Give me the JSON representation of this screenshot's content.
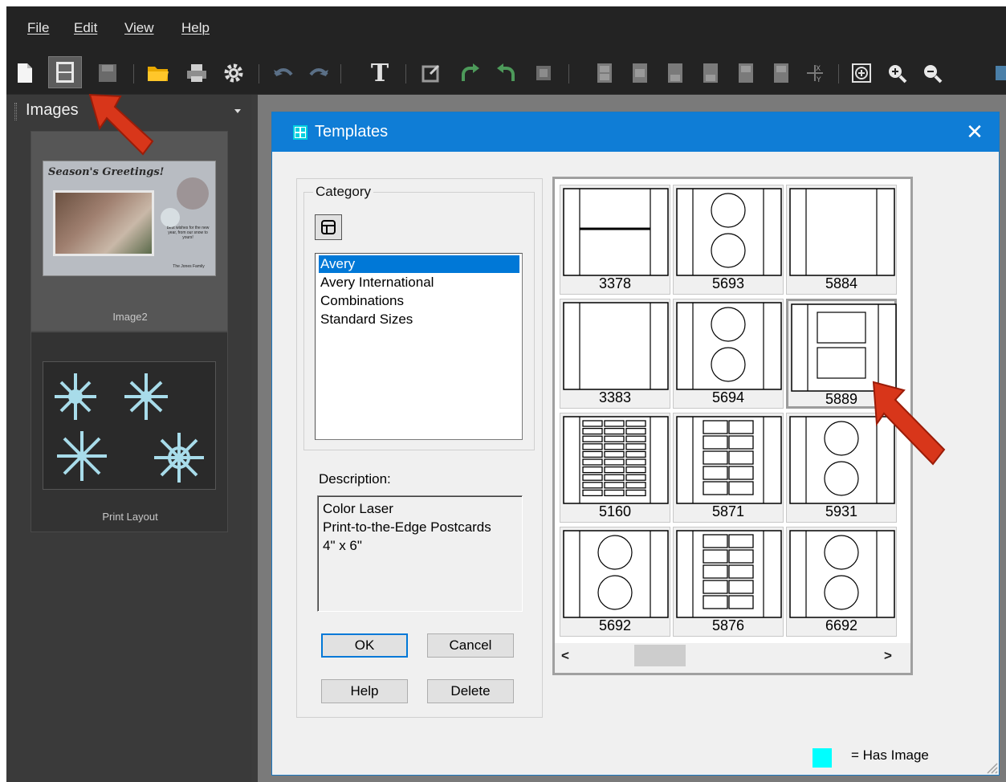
{
  "menu": {
    "file": "File",
    "edit": "Edit",
    "view": "View",
    "help": "Help"
  },
  "toolbar": {
    "items": [
      "new-document-icon",
      "layout-icon",
      "save-icon",
      "open-folder-icon",
      "print-icon",
      "settings-icon",
      "undo-icon",
      "redo-icon",
      "text-icon",
      "edit-image-icon",
      "rotate-right-icon",
      "rotate-left-icon",
      "crop-icon",
      "grid-icon-1",
      "grid-icon-2",
      "grid-icon-3",
      "grid-icon-4",
      "grid-icon-5",
      "grid-icon-6",
      "xy-icon",
      "fit-icon",
      "zoom-in-icon",
      "zoom-out-icon"
    ]
  },
  "images_panel": {
    "title": "Images",
    "items": [
      {
        "label": "Image2",
        "selected": true
      },
      {
        "label": "Print Layout",
        "selected": false
      }
    ],
    "postcard": {
      "heading": "Season's Greetings!",
      "message": "Best wishes for the new year, from our snow to yours!",
      "signature": "The Jones Family"
    }
  },
  "dialog": {
    "title": "Templates",
    "category_label": "Category",
    "categories": [
      {
        "label": "Avery",
        "selected": true
      },
      {
        "label": "Avery International",
        "selected": false
      },
      {
        "label": "Combinations",
        "selected": false
      },
      {
        "label": "Standard Sizes",
        "selected": false
      }
    ],
    "description_label": "Description:",
    "description_lines": [
      "Color Laser",
      "Print-to-the-Edge Postcards",
      "4\" x 6\""
    ],
    "buttons": {
      "ok": "OK",
      "cancel": "Cancel",
      "help": "Help",
      "delete": "Delete"
    },
    "templates": [
      {
        "id": "3378",
        "layout": "hsplit"
      },
      {
        "id": "5693",
        "layout": "two-circles"
      },
      {
        "id": "5884",
        "layout": "full"
      },
      {
        "id": "3383",
        "layout": "full"
      },
      {
        "id": "5694",
        "layout": "two-circles"
      },
      {
        "id": "5889",
        "layout": "two-rects",
        "highlighted": true
      },
      {
        "id": "5160",
        "layout": "labels-3col"
      },
      {
        "id": "5871",
        "layout": "cards-2col"
      },
      {
        "id": "5931",
        "layout": "two-circles"
      },
      {
        "id": "5692",
        "layout": "two-circles"
      },
      {
        "id": "5876",
        "layout": "cards-2col"
      },
      {
        "id": "6692",
        "layout": "two-circles"
      }
    ],
    "scroll_left": "<",
    "scroll_right": ">",
    "legend": {
      "color": "#00ffff",
      "text": "= Has Image"
    }
  },
  "colors": {
    "accent": "#0f7dd6",
    "selection": "#0078d7",
    "annotation_arrow": "#d8361a"
  }
}
